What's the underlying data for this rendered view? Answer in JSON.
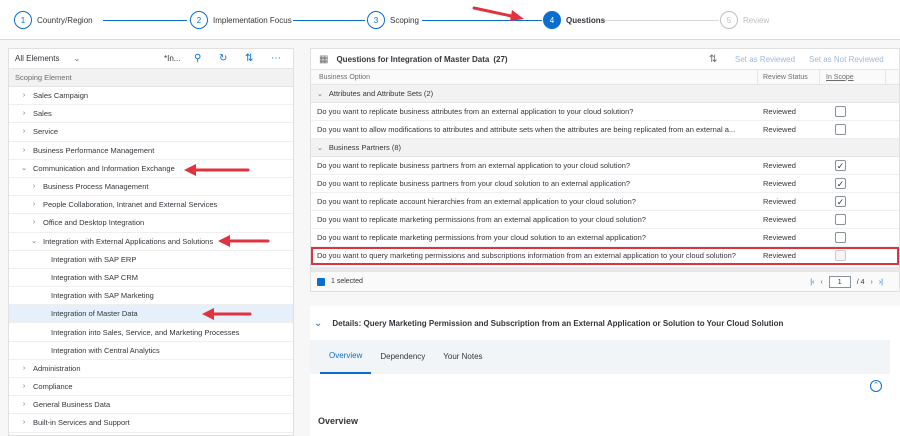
{
  "wizard": {
    "steps": [
      {
        "num": "1",
        "label": "Country/Region"
      },
      {
        "num": "2",
        "label": "Implementation Focus"
      },
      {
        "num": "3",
        "label": "Scoping"
      },
      {
        "num": "4",
        "label": "Questions"
      },
      {
        "num": "5",
        "label": "Review"
      }
    ]
  },
  "left": {
    "dropdown": "All Elements",
    "search_text": "*In...",
    "column_header": "Scoping Element",
    "tree": [
      {
        "label": "Sales Campaign",
        "level": 0,
        "toggle": "›"
      },
      {
        "label": "Sales",
        "level": 0,
        "toggle": "›"
      },
      {
        "label": "Service",
        "level": 0,
        "toggle": "›"
      },
      {
        "label": "Business Performance Management",
        "level": 0,
        "toggle": "›"
      },
      {
        "label": "Communication and Information Exchange",
        "level": 0,
        "toggle": "⌄"
      },
      {
        "label": "Business Process Management",
        "level": 1,
        "toggle": "›"
      },
      {
        "label": "People Collaboration, Intranet and External Services",
        "level": 1,
        "toggle": "›"
      },
      {
        "label": "Office and Desktop Integration",
        "level": 1,
        "toggle": "›"
      },
      {
        "label": "Integration with External Applications and Solutions",
        "level": 1,
        "toggle": "⌄"
      },
      {
        "label": "Integration with SAP ERP",
        "level": 2,
        "toggle": ""
      },
      {
        "label": "Integration with SAP CRM",
        "level": 2,
        "toggle": ""
      },
      {
        "label": "Integration with SAP Marketing",
        "level": 2,
        "toggle": ""
      },
      {
        "label": "Integration of Master Data",
        "level": 2,
        "toggle": "",
        "selected": true
      },
      {
        "label": "Integration into Sales, Service, and Marketing Processes",
        "level": 2,
        "toggle": ""
      },
      {
        "label": "Integration with Central Analytics",
        "level": 2,
        "toggle": ""
      },
      {
        "label": "Administration",
        "level": 0,
        "toggle": "›"
      },
      {
        "label": "Compliance",
        "level": 0,
        "toggle": "›"
      },
      {
        "label": "General Business Data",
        "level": 0,
        "toggle": "›"
      },
      {
        "label": "Built-in Services and Support",
        "level": 0,
        "toggle": "›"
      }
    ]
  },
  "questions": {
    "title": "Questions for Integration of Master Data",
    "count": "(27)",
    "set_reviewed": "Set as Reviewed",
    "set_not_reviewed": "Set as Not Reviewed",
    "col_option": "Business Option",
    "col_status": "Review Status",
    "col_scope": "In Scope",
    "groups": [
      {
        "label": "Attributes and Attribute Sets (2)",
        "rows": [
          {
            "q": "Do you want to replicate business attributes from an external application to your cloud solution?",
            "status": "Reviewed",
            "checked": false
          },
          {
            "q": "Do you want to allow modifications to attributes and attribute sets when the attributes are being replicated from an external a...",
            "status": "Reviewed",
            "checked": false
          }
        ]
      },
      {
        "label": "Business Partners (8)",
        "rows": [
          {
            "q": "Do you want to replicate business partners from an external application to your cloud solution?",
            "status": "Reviewed",
            "checked": true
          },
          {
            "q": "Do you want to replicate business partners from your cloud solution to an external application?",
            "status": "Reviewed",
            "checked": true
          },
          {
            "q": "Do you want to replicate account hierarchies from an external application to your cloud solution?",
            "status": "Reviewed",
            "checked": true
          },
          {
            "q": "Do you want to replicate marketing permissions from an external application to your cloud solution?",
            "status": "Reviewed",
            "checked": false
          },
          {
            "q": "Do you want to replicate marketing permissions from your cloud solution to an external application?",
            "status": "Reviewed",
            "checked": false
          },
          {
            "q": "Do you want to query marketing permissions and subscriptions information from an external application to your cloud solution?",
            "status": "Reviewed",
            "checked": false,
            "highlight": true
          }
        ]
      }
    ],
    "selected_text": "1 selected",
    "page": "1",
    "page_total": "/ 4"
  },
  "details": {
    "title": "Details: Query Marketing Permission and Subscription from an External Application or Solution to Your Cloud Solution",
    "tabs": [
      "Overview",
      "Dependency",
      "Your Notes"
    ],
    "overview_heading": "Overview"
  },
  "colors": {
    "accent": "#0a6ed1",
    "annotation": "#e0323f"
  }
}
